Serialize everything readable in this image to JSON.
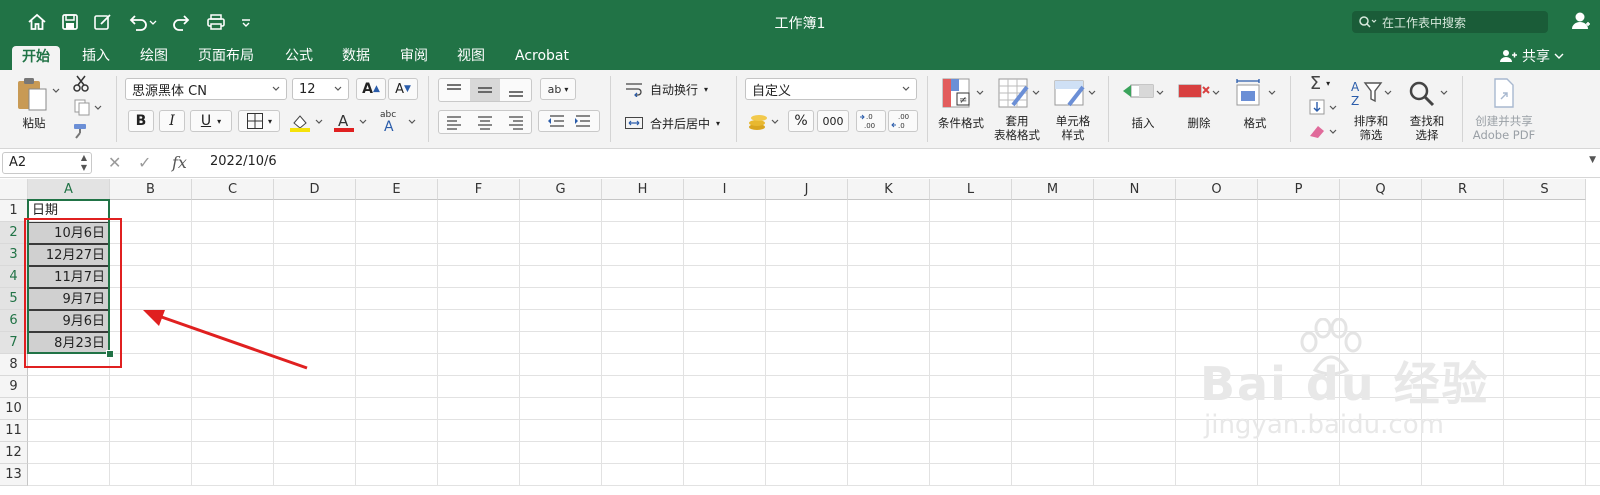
{
  "window": {
    "title": "工作簿1"
  },
  "quick_access": [
    {
      "icon": "home-icon"
    },
    {
      "icon": "save-icon"
    },
    {
      "icon": "edit-icon"
    },
    {
      "icon": "undo-icon"
    },
    {
      "icon": "redo-icon"
    },
    {
      "icon": "print-icon"
    },
    {
      "icon": "customize-icon"
    }
  ],
  "search": {
    "placeholder": "在工作表中搜索"
  },
  "tabs": [
    "开始",
    "插入",
    "绘图",
    "页面布局",
    "公式",
    "数据",
    "审阅",
    "视图",
    "Acrobat"
  ],
  "share_label": "共享",
  "ribbon": {
    "paste_label": "粘贴",
    "font_name": "思源黑体 CN",
    "font_size": "12",
    "bold": "B",
    "italic": "I",
    "underline": "U",
    "wrap_text": "自动换行",
    "merge_center": "合并后居中",
    "number_format": "自定义",
    "percent": "%",
    "comma": "000",
    "cond_format": "条件格式",
    "table_format": [
      "套用",
      "表格格式"
    ],
    "cell_style": [
      "单元格",
      "样式"
    ],
    "insert": "插入",
    "delete": "删除",
    "format": "格式",
    "sort_filter": [
      "排序和",
      "筛选"
    ],
    "find_select": [
      "查找和",
      "选择"
    ],
    "adobe_pdf": [
      "创建并共享",
      "Adobe PDF"
    ]
  },
  "formula_bar": {
    "cell_ref": "A2",
    "fx": "fx",
    "value": "2022/10/6"
  },
  "columns": [
    "A",
    "B",
    "C",
    "D",
    "E",
    "F",
    "G",
    "H",
    "I",
    "J",
    "K",
    "L",
    "M",
    "N",
    "O",
    "P",
    "Q",
    "R",
    "S"
  ],
  "rows": [
    "1",
    "2",
    "3",
    "4",
    "5",
    "6",
    "7",
    "8",
    "9",
    "10",
    "11",
    "12",
    "13"
  ],
  "cells": {
    "A1": "日期",
    "A2": "10月6日",
    "A3": "12月27日",
    "A4": "11月7日",
    "A5": "9月7日",
    "A6": "9月6日",
    "A7": "8月23日"
  },
  "watermark": {
    "brand": "Bai du 经验",
    "url": "jingyan.baidu.com"
  },
  "colors": {
    "excel_green": "#217346",
    "annotation_red": "#e02020",
    "selected_fill": "#d0d0d0"
  }
}
